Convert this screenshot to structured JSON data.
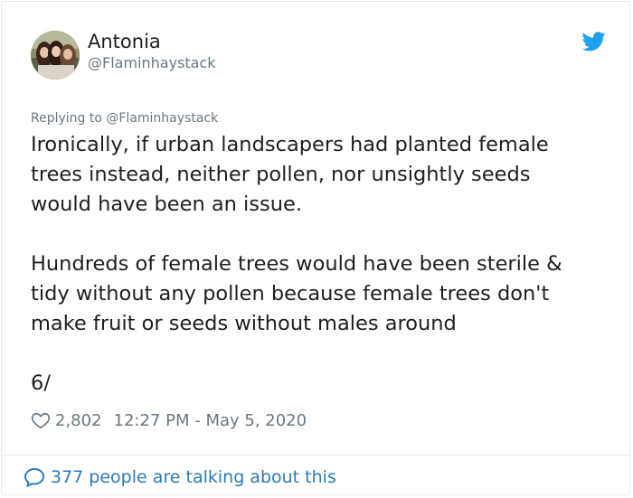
{
  "tweet": {
    "author_name": "Antonia",
    "author_handle": "@Flaminhaystack",
    "replying_to": "Replying to @Flaminhaystack",
    "text": "Ironically, if urban landscapers had planted female\ntrees instead, neither pollen, nor unsightly seeds\nwould have been an issue.\n\nHundreds of female trees would have been sterile &\ntidy without any pollen because female trees don't\nmake fruit or seeds without males around\n\n6/",
    "likes": "2,802",
    "timestamp": "12:27 PM - May 5, 2020",
    "conversation_link": "377 people are talking about this"
  },
  "icons": {
    "brand": "twitter-bird-icon",
    "like": "heart-icon",
    "conversation": "speech-bubble-icon"
  },
  "colors": {
    "twitter_blue": "#1da1f2",
    "link_blue": "#2b7bb9",
    "secondary_text": "#697882",
    "border": "#e1e8ed"
  }
}
